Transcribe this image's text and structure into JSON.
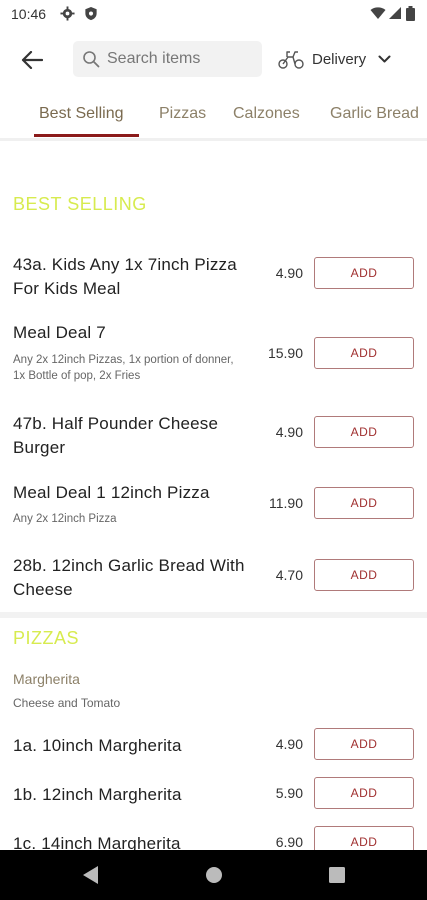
{
  "status_bar": {
    "time": "10:46"
  },
  "search": {
    "placeholder": "Search items"
  },
  "delivery": {
    "label": "Delivery"
  },
  "tabs": [
    {
      "label": "Best Selling"
    },
    {
      "label": "Pizzas"
    },
    {
      "label": "Calzones"
    },
    {
      "label": "Garlic Bread"
    }
  ],
  "sections": [
    {
      "title": "BEST SELLING",
      "items": [
        {
          "name": "43a. Kids Any 1x 7inch Pizza For Kids Meal",
          "desc": "",
          "price": "4.90",
          "button": "ADD"
        },
        {
          "name": "Meal Deal 7",
          "desc": "Any 2x 12inch Pizzas, 1x portion of donner, 1x Bottle of pop, 2x Fries",
          "price": "15.90",
          "button": "ADD"
        },
        {
          "name": "47b. Half Pounder Cheese Burger",
          "desc": "",
          "price": "4.90",
          "button": "ADD"
        },
        {
          "name": "Meal Deal 1 12inch Pizza",
          "desc": "Any 2x 12inch Pizza",
          "price": "11.90",
          "button": "ADD"
        },
        {
          "name": "28b. 12inch Garlic Bread With Cheese",
          "desc": "",
          "price": "4.70",
          "button": "ADD"
        }
      ]
    },
    {
      "title": "PIZZAS",
      "subcategory": {
        "name": "Margherita",
        "desc": "Cheese and Tomato"
      },
      "items": [
        {
          "name": "1a. 10inch Margherita",
          "price": "4.90",
          "button": "ADD"
        },
        {
          "name": "1b. 12inch Margherita",
          "price": "5.90",
          "button": "ADD"
        },
        {
          "name": "1c. 14inch Margherita",
          "price": "6.90",
          "button": "ADD"
        }
      ]
    }
  ]
}
